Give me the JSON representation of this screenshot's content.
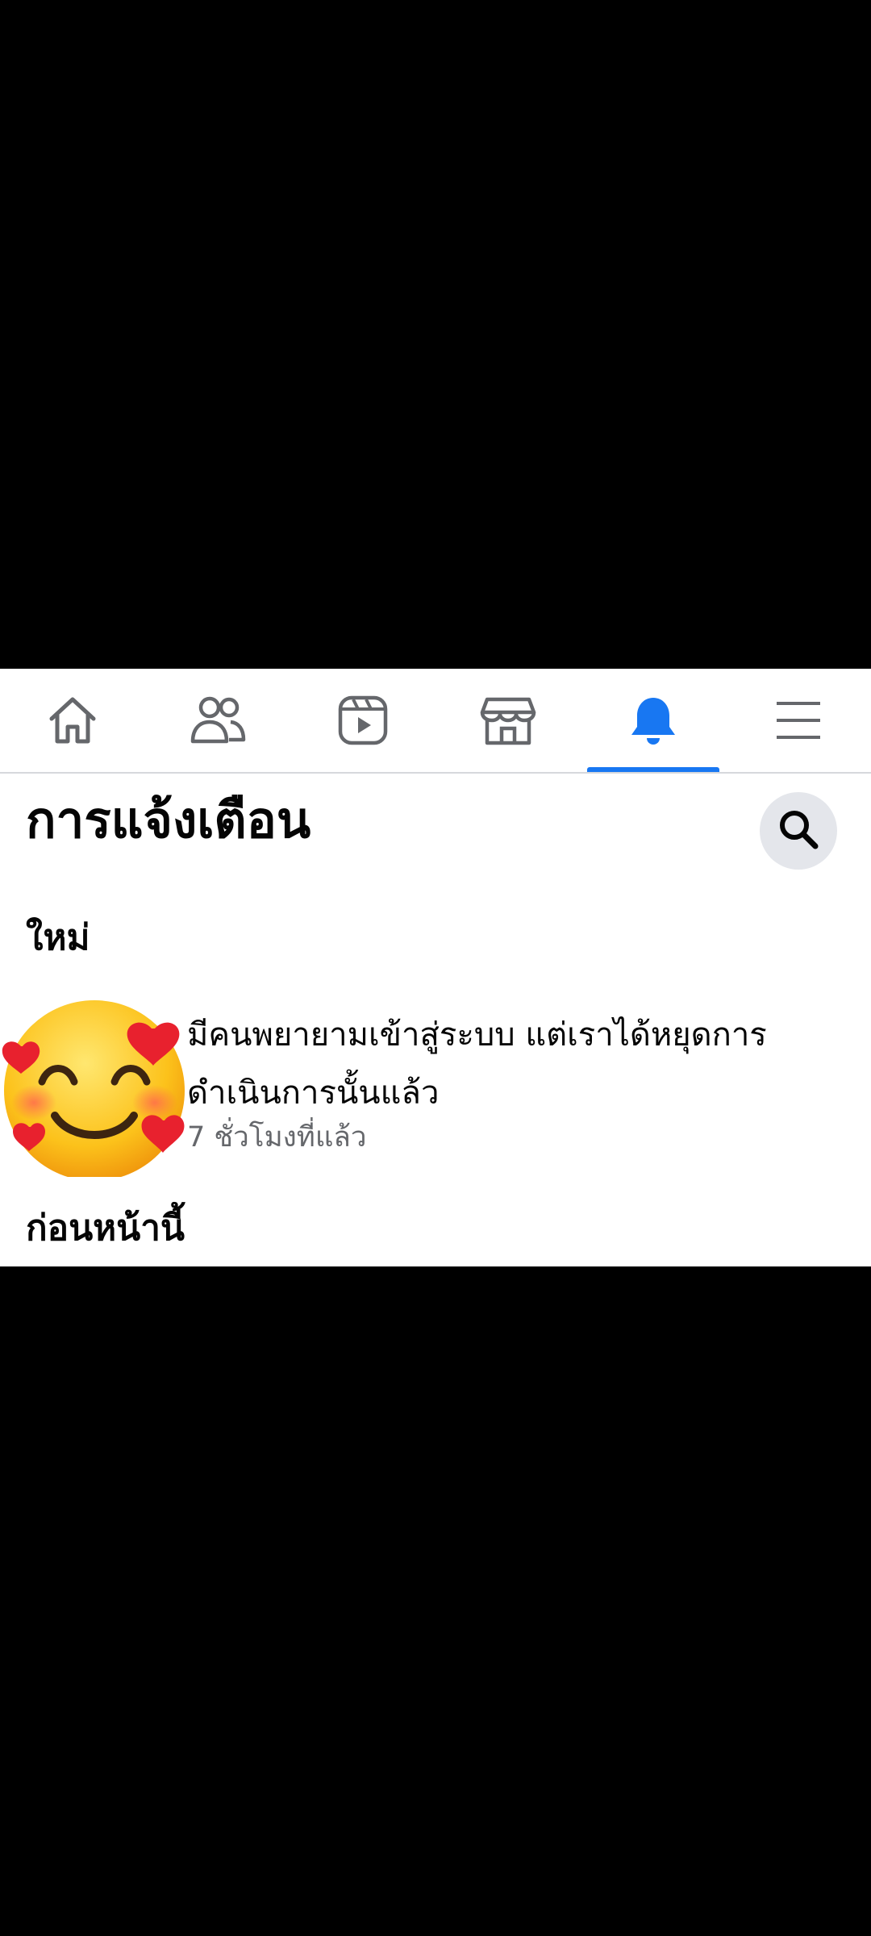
{
  "navbar": {
    "tabs": [
      {
        "icon": "home-icon",
        "active": false
      },
      {
        "icon": "friends-icon",
        "active": false
      },
      {
        "icon": "video-icon",
        "active": false
      },
      {
        "icon": "marketplace-icon",
        "active": false
      },
      {
        "icon": "bell-icon",
        "active": true
      },
      {
        "icon": "menu-icon",
        "active": false
      }
    ],
    "accent_color": "#1877f2",
    "inactive_color": "#65676b"
  },
  "header": {
    "title": "การแจ้งเตือน",
    "search_icon": "search-icon"
  },
  "sections": {
    "new_label": "ใหม่",
    "earlier_label": "ก่อนหน้านี้"
  },
  "notifications": [
    {
      "avatar_icon": "smiling-face-with-hearts-emoji",
      "text": "มีคนพยายามเข้าสู่ระบบ แต่เราได้หยุดการดำเนินการนั้นแล้ว",
      "time": "7 ชั่วโมงที่แล้ว"
    }
  ]
}
